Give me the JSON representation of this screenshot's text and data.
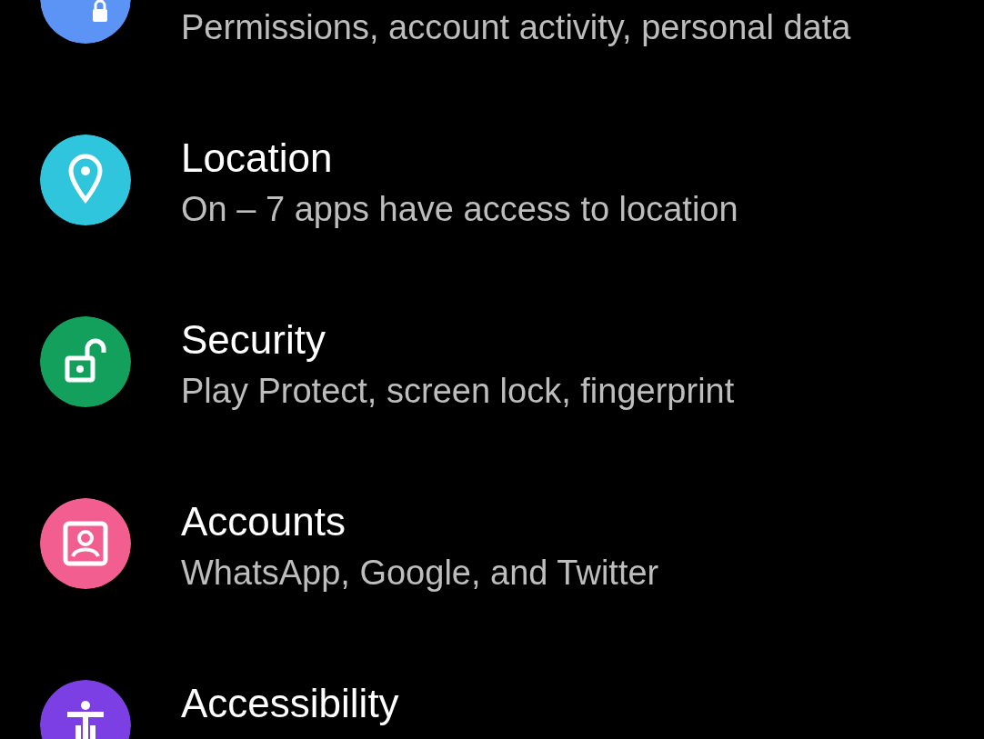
{
  "settings": [
    {
      "kind": "privacy",
      "color": "#5b94f5",
      "subtitle": "Permissions, account activity, personal data"
    },
    {
      "kind": "location",
      "color": "#2fc6dd",
      "title": "Location",
      "subtitle": "On – 7 apps have access to location"
    },
    {
      "kind": "security",
      "color": "#12a05c",
      "title": "Security",
      "subtitle": "Play Protect, screen lock, fingerprint"
    },
    {
      "kind": "accounts",
      "color": "#f25e8f",
      "title": "Accounts",
      "subtitle": "WhatsApp, Google, and Twitter"
    },
    {
      "kind": "accessibility",
      "color": "#7b3fe4",
      "title": "Accessibility"
    }
  ]
}
